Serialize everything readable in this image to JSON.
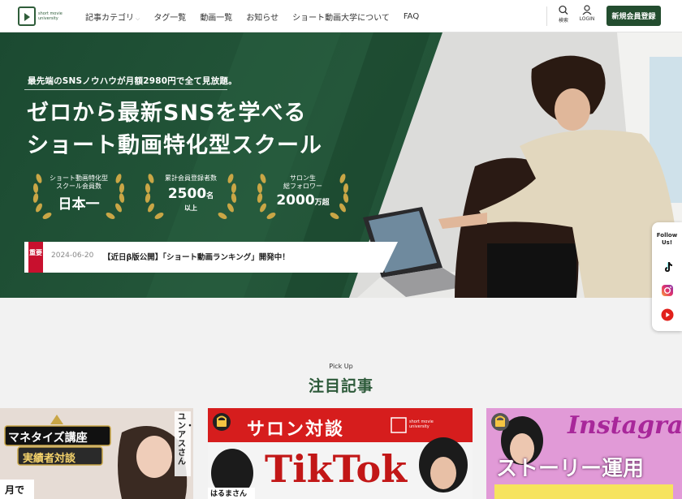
{
  "header": {
    "logo_text": "short movie university",
    "nav": [
      {
        "label": "記事カテゴリ",
        "chevron": "⌵"
      },
      {
        "label": "タグ一覧"
      },
      {
        "label": "動画一覧"
      },
      {
        "label": "お知らせ"
      },
      {
        "label": "ショート動画大学について"
      },
      {
        "label": "FAQ"
      }
    ],
    "search_label": "検索",
    "login_label": "LOGIN",
    "signup_label": "新規会員登録"
  },
  "hero": {
    "subtitle": "最先端のSNSノウハウが月額2980円で全て見放題。",
    "title_line1": "ゼロから最新SNSを学べる",
    "title_line2": "ショート動画特化型スクール",
    "awards": [
      {
        "line1": "ショート動画特化型",
        "line2": "スクール会員数",
        "big": "日本一",
        "unit": "",
        "extra": ""
      },
      {
        "line1": "累計会員登録者数",
        "line2": "",
        "big": "2500",
        "unit": "名",
        "extra": "以上"
      },
      {
        "line1": "サロン生",
        "line2": "総フォロワー",
        "big": "2000",
        "unit": "万超",
        "extra": ""
      }
    ],
    "news": {
      "tag": "重要",
      "date": "2024-06-20",
      "text": "【近日β版公開】「ショート動画ランキング」開発中！"
    }
  },
  "follow": {
    "label_line1": "Follow",
    "label_line2": "Us!",
    "icons": [
      "tiktok-icon",
      "instagram-icon",
      "youtube-icon"
    ]
  },
  "pickup": {
    "label_en": "Pick Up",
    "label_jp": "注目記事"
  },
  "cards": [
    {
      "line1": "マネタイズ講座",
      "line2": "実績者対談",
      "name": "ユン・アスさん",
      "small": "月で"
    },
    {
      "title": "サロン対談",
      "sub": "short movie university",
      "big": "TikTok",
      "name": "はるまさん"
    },
    {
      "title": "Instagram",
      "big": "ストーリー運用"
    }
  ],
  "colors": {
    "brand_green": "#234d2f",
    "accent_red": "#c8102e",
    "gold": "#c9a646"
  }
}
